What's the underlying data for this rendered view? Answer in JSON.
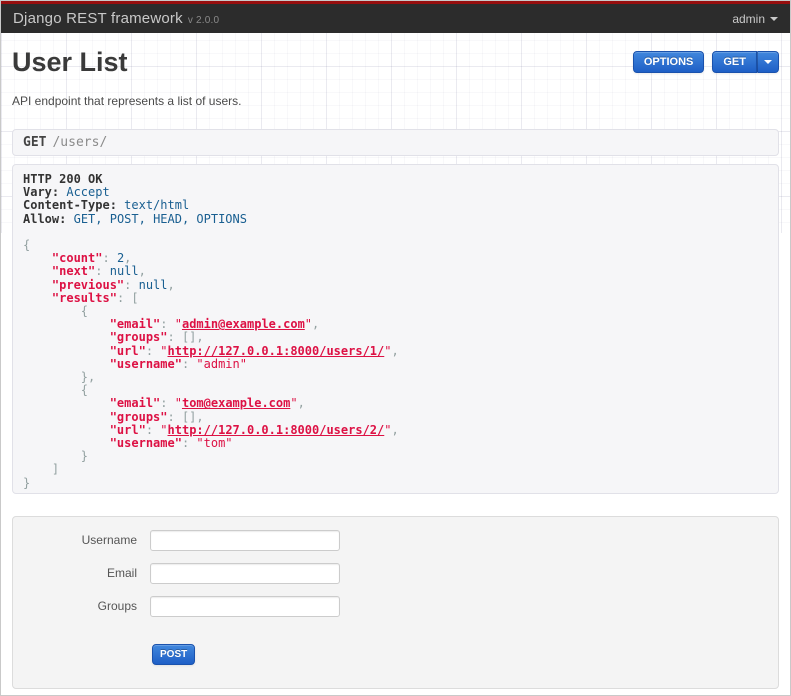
{
  "header": {
    "brand": "Django REST framework",
    "version": "v 2.0.0",
    "user_menu_label": "admin"
  },
  "toolbar": {
    "options_label": "OPTIONS",
    "get_label": "GET"
  },
  "page": {
    "title": "User List",
    "description": "API endpoint that represents a list of users."
  },
  "request": {
    "method": "GET",
    "path": "/users/"
  },
  "response": {
    "status_line": "HTTP 200 OK",
    "headers": {
      "Vary": "Accept",
      "Content-Type": "text/html",
      "Allow": "GET, POST, HEAD, OPTIONS"
    },
    "body": {
      "count": 2,
      "next": null,
      "previous": null,
      "results": [
        {
          "email": "admin@example.com",
          "groups": [],
          "url": "http://127.0.0.1:8000/users/1/",
          "username": "admin"
        },
        {
          "email": "tom@example.com",
          "groups": [],
          "url": "http://127.0.0.1:8000/users/2/",
          "username": "tom"
        }
      ]
    },
    "lines": [
      [
        {
          "c": "hdr",
          "t": "HTTP 200 OK"
        }
      ],
      [
        {
          "c": "hdr",
          "t": "Vary:"
        },
        {
          "c": "pln",
          "t": " "
        },
        {
          "c": "val",
          "t": "Accept"
        }
      ],
      [
        {
          "c": "hdr",
          "t": "Content-Type:"
        },
        {
          "c": "pln",
          "t": " "
        },
        {
          "c": "val",
          "t": "text/html"
        }
      ],
      [
        {
          "c": "hdr",
          "t": "Allow:"
        },
        {
          "c": "pln",
          "t": " "
        },
        {
          "c": "val",
          "t": "GET, POST, HEAD, OPTIONS"
        }
      ],
      [],
      [
        {
          "c": "pun",
          "t": "{"
        }
      ],
      [
        {
          "c": "pln",
          "t": "    "
        },
        {
          "c": "key",
          "t": "\"count\""
        },
        {
          "c": "pun",
          "t": ": "
        },
        {
          "c": "lit",
          "t": "2"
        },
        {
          "c": "pun",
          "t": ","
        }
      ],
      [
        {
          "c": "pln",
          "t": "    "
        },
        {
          "c": "key",
          "t": "\"next\""
        },
        {
          "c": "pun",
          "t": ": "
        },
        {
          "c": "lit",
          "t": "null"
        },
        {
          "c": "pun",
          "t": ","
        }
      ],
      [
        {
          "c": "pln",
          "t": "    "
        },
        {
          "c": "key",
          "t": "\"previous\""
        },
        {
          "c": "pun",
          "t": ": "
        },
        {
          "c": "lit",
          "t": "null"
        },
        {
          "c": "pun",
          "t": ","
        }
      ],
      [
        {
          "c": "pln",
          "t": "    "
        },
        {
          "c": "key",
          "t": "\"results\""
        },
        {
          "c": "pun",
          "t": ": ["
        }
      ],
      [
        {
          "c": "pln",
          "t": "        "
        },
        {
          "c": "pun",
          "t": "{"
        }
      ],
      [
        {
          "c": "pln",
          "t": "            "
        },
        {
          "c": "key",
          "t": "\"email\""
        },
        {
          "c": "pun",
          "t": ": "
        },
        {
          "c": "str",
          "t": "\""
        },
        {
          "c": "lnk",
          "t": "admin@example.com"
        },
        {
          "c": "str",
          "t": "\""
        },
        {
          "c": "pun",
          "t": ","
        }
      ],
      [
        {
          "c": "pln",
          "t": "            "
        },
        {
          "c": "key",
          "t": "\"groups\""
        },
        {
          "c": "pun",
          "t": ": [],"
        }
      ],
      [
        {
          "c": "pln",
          "t": "            "
        },
        {
          "c": "key",
          "t": "\"url\""
        },
        {
          "c": "pun",
          "t": ": "
        },
        {
          "c": "str",
          "t": "\""
        },
        {
          "c": "lnk",
          "t": "http://127.0.0.1:8000/users/1/"
        },
        {
          "c": "str",
          "t": "\""
        },
        {
          "c": "pun",
          "t": ","
        }
      ],
      [
        {
          "c": "pln",
          "t": "            "
        },
        {
          "c": "key",
          "t": "\"username\""
        },
        {
          "c": "pun",
          "t": ": "
        },
        {
          "c": "str",
          "t": "\"admin\""
        }
      ],
      [
        {
          "c": "pln",
          "t": "        "
        },
        {
          "c": "pun",
          "t": "},"
        }
      ],
      [
        {
          "c": "pln",
          "t": "        "
        },
        {
          "c": "pun",
          "t": "{"
        }
      ],
      [
        {
          "c": "pln",
          "t": "            "
        },
        {
          "c": "key",
          "t": "\"email\""
        },
        {
          "c": "pun",
          "t": ": "
        },
        {
          "c": "str",
          "t": "\""
        },
        {
          "c": "lnk",
          "t": "tom@example.com"
        },
        {
          "c": "str",
          "t": "\""
        },
        {
          "c": "pun",
          "t": ","
        }
      ],
      [
        {
          "c": "pln",
          "t": "            "
        },
        {
          "c": "key",
          "t": "\"groups\""
        },
        {
          "c": "pun",
          "t": ": [],"
        }
      ],
      [
        {
          "c": "pln",
          "t": "            "
        },
        {
          "c": "key",
          "t": "\"url\""
        },
        {
          "c": "pun",
          "t": ": "
        },
        {
          "c": "str",
          "t": "\""
        },
        {
          "c": "lnk",
          "t": "http://127.0.0.1:8000/users/2/"
        },
        {
          "c": "str",
          "t": "\""
        },
        {
          "c": "pun",
          "t": ","
        }
      ],
      [
        {
          "c": "pln",
          "t": "            "
        },
        {
          "c": "key",
          "t": "\"username\""
        },
        {
          "c": "pun",
          "t": ": "
        },
        {
          "c": "str",
          "t": "\"tom\""
        }
      ],
      [
        {
          "c": "pln",
          "t": "        "
        },
        {
          "c": "pun",
          "t": "}"
        }
      ],
      [
        {
          "c": "pln",
          "t": "    "
        },
        {
          "c": "pun",
          "t": "]"
        }
      ],
      [
        {
          "c": "pun",
          "t": "}"
        }
      ]
    ]
  },
  "form": {
    "fields": [
      {
        "name": "username",
        "label": "Username",
        "value": "",
        "placeholder": ""
      },
      {
        "name": "email",
        "label": "Email",
        "value": "",
        "placeholder": ""
      },
      {
        "name": "groups",
        "label": "Groups",
        "value": "",
        "placeholder": ""
      }
    ],
    "submit_label": "POST"
  },
  "colors": {
    "accent_top_stripe": "#970f0f",
    "navbar_bg": "#2c2c2c",
    "button_blue_top": "#4187dd",
    "button_blue_bottom": "#1e5fc6",
    "code_key_string": "#dd1144",
    "code_literal": "#195f91",
    "code_punctuation": "#93a1a1",
    "panel_bg": "#f6f6f8",
    "panel_border": "#e1e1e8"
  }
}
